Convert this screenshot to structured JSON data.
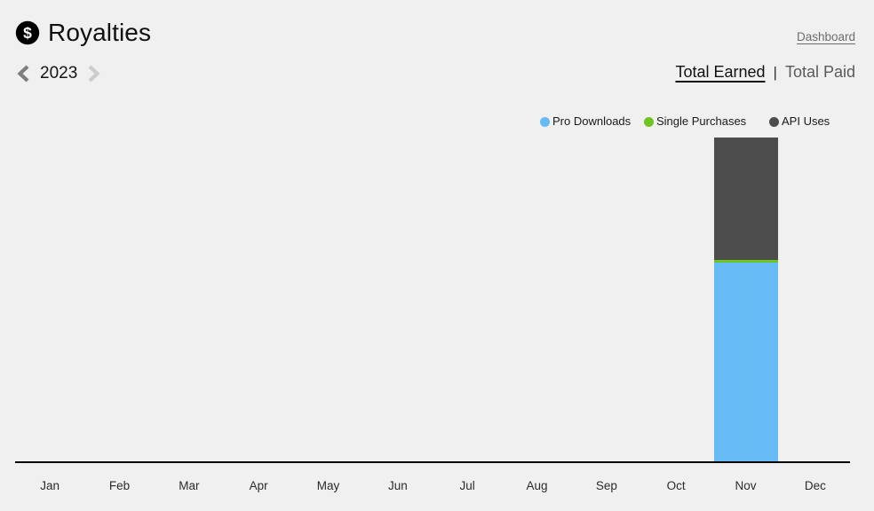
{
  "header": {
    "title": "Royalties",
    "icon": "dollar-circle-icon",
    "dashboard_link": "Dashboard"
  },
  "year_nav": {
    "prev_icon": "chevron-left-icon",
    "next_icon": "chevron-right-icon",
    "year": "2023",
    "prev_color": "#7d7d7d",
    "next_color": "#cccccc"
  },
  "view_toggle": {
    "active": "Total Earned",
    "separator": "|",
    "inactive": "Total Paid"
  },
  "colors": {
    "background": "#f0f0f0",
    "pro_downloads": "#66bbf5",
    "single_purchases": "#6ec420",
    "api_uses": "#4d4d4d",
    "axis": "#000000",
    "text": "#1a1a1a"
  },
  "chart_data": {
    "type": "bar",
    "title": "",
    "xlabel": "",
    "ylabel": "",
    "stacked": true,
    "grid": false,
    "legend_position": "top-right",
    "categories": [
      "Jan",
      "Feb",
      "Mar",
      "Apr",
      "May",
      "Jun",
      "Jul",
      "Aug",
      "Sep",
      "Oct",
      "Nov",
      "Dec"
    ],
    "ylim": [
      0,
      100
    ],
    "series": [
      {
        "name": "Pro Downloads",
        "color": "#66bbf5",
        "values": [
          0,
          0,
          0,
          0,
          0,
          0,
          0,
          0,
          0,
          0,
          60.6,
          0
        ]
      },
      {
        "name": "Single Purchases",
        "color": "#6ec420",
        "values": [
          0,
          0,
          0,
          0,
          0,
          0,
          0,
          0,
          0,
          0,
          0.8,
          0
        ]
      },
      {
        "name": "API Uses",
        "color": "#4d4d4d",
        "values": [
          0,
          0,
          0,
          0,
          0,
          0,
          0,
          0,
          0,
          0,
          37.2,
          0
        ]
      }
    ]
  }
}
